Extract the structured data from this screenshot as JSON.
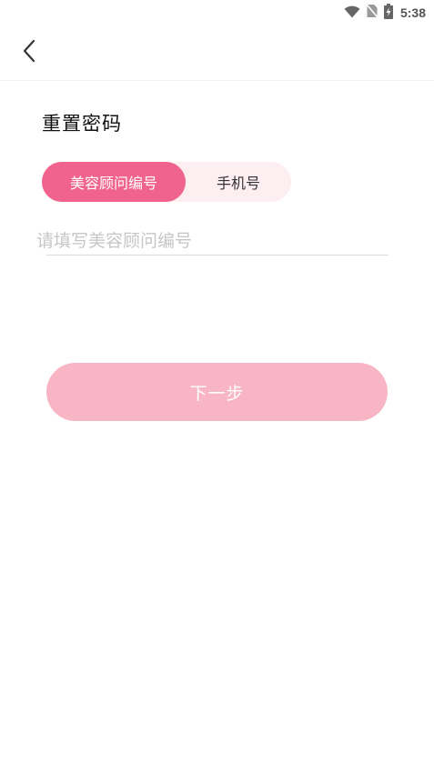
{
  "status_bar": {
    "time": "5:38",
    "icons": [
      "wifi-icon",
      "no-sim-icon",
      "battery-charging-icon"
    ]
  },
  "header": {
    "back_icon": "chevron-left-icon"
  },
  "page": {
    "title": "重置密码"
  },
  "tabs": {
    "items": [
      {
        "label": "美容顾问编号",
        "active": true
      },
      {
        "label": "手机号",
        "active": false
      }
    ]
  },
  "form": {
    "code_placeholder": "请填写美容顾问编号",
    "code_value": ""
  },
  "actions": {
    "next_label": "下一步"
  },
  "colors": {
    "accent": "#f0638f",
    "accent_light": "#fdeef2",
    "button_disabled": "#f8b6c5"
  }
}
